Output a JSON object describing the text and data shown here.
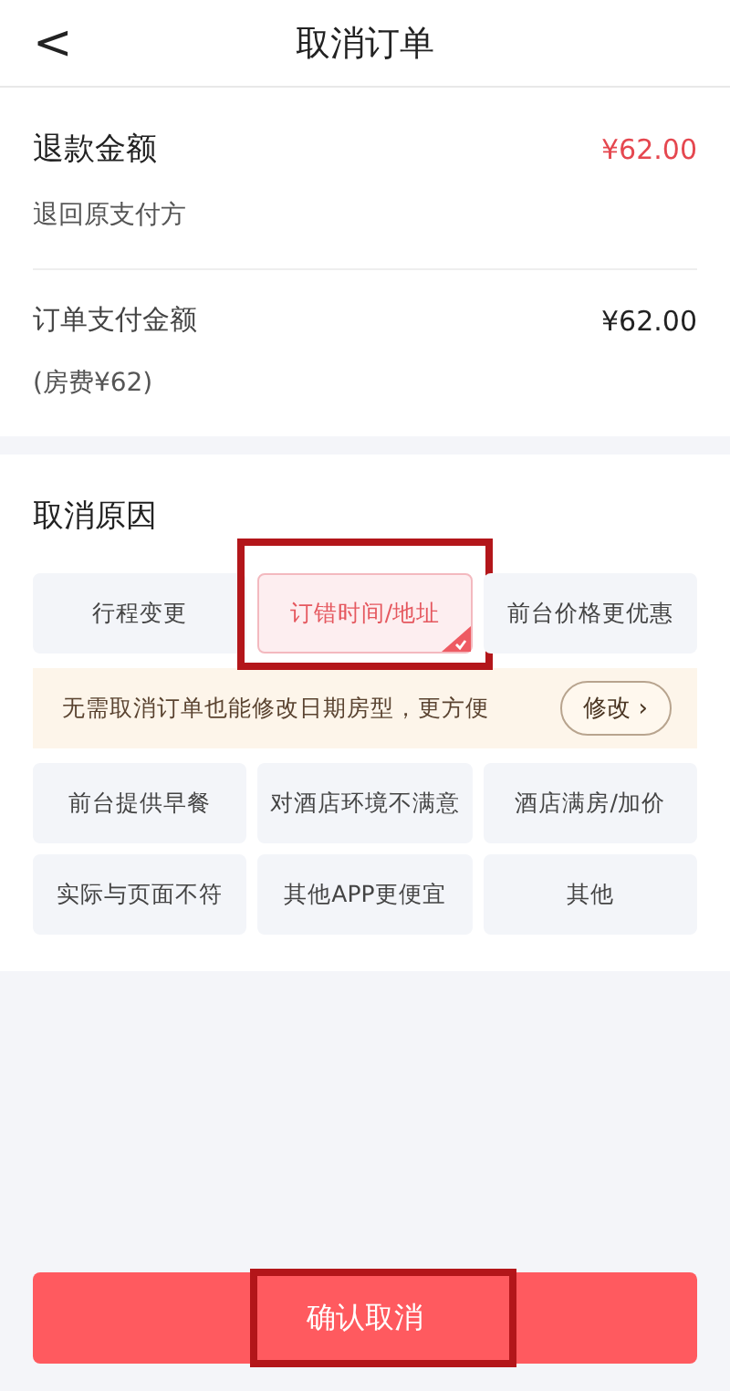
{
  "header": {
    "back": "<",
    "title": "取消订单"
  },
  "refund": {
    "label": "退款金额",
    "amount": "¥62.00",
    "note": "退回原支付方"
  },
  "payment": {
    "label": "订单支付金额",
    "amount": "¥62.00",
    "note": "(房费¥62)"
  },
  "reasons_title": "取消原因",
  "reasons": [
    {
      "label": "行程变更",
      "selected": false,
      "annotated": false
    },
    {
      "label": "订错时间/地址",
      "selected": true,
      "annotated": true
    },
    {
      "label": "前台价格更优惠",
      "selected": false,
      "annotated": false
    },
    {
      "label": "前台提供早餐",
      "selected": false,
      "annotated": false
    },
    {
      "label": "对酒店环境不满意",
      "selected": false,
      "annotated": false
    },
    {
      "label": "酒店满房/加价",
      "selected": false,
      "annotated": false
    },
    {
      "label": "实际与页面不符",
      "selected": false,
      "annotated": false
    },
    {
      "label": "其他APP更便宜",
      "selected": false,
      "annotated": false
    },
    {
      "label": "其他",
      "selected": false,
      "annotated": false
    }
  ],
  "tip": {
    "text": "无需取消订单也能修改日期房型，更方便",
    "button": "修改",
    "button_arrow": "›"
  },
  "confirm_button": {
    "label": "确认取消",
    "annotated": true
  }
}
